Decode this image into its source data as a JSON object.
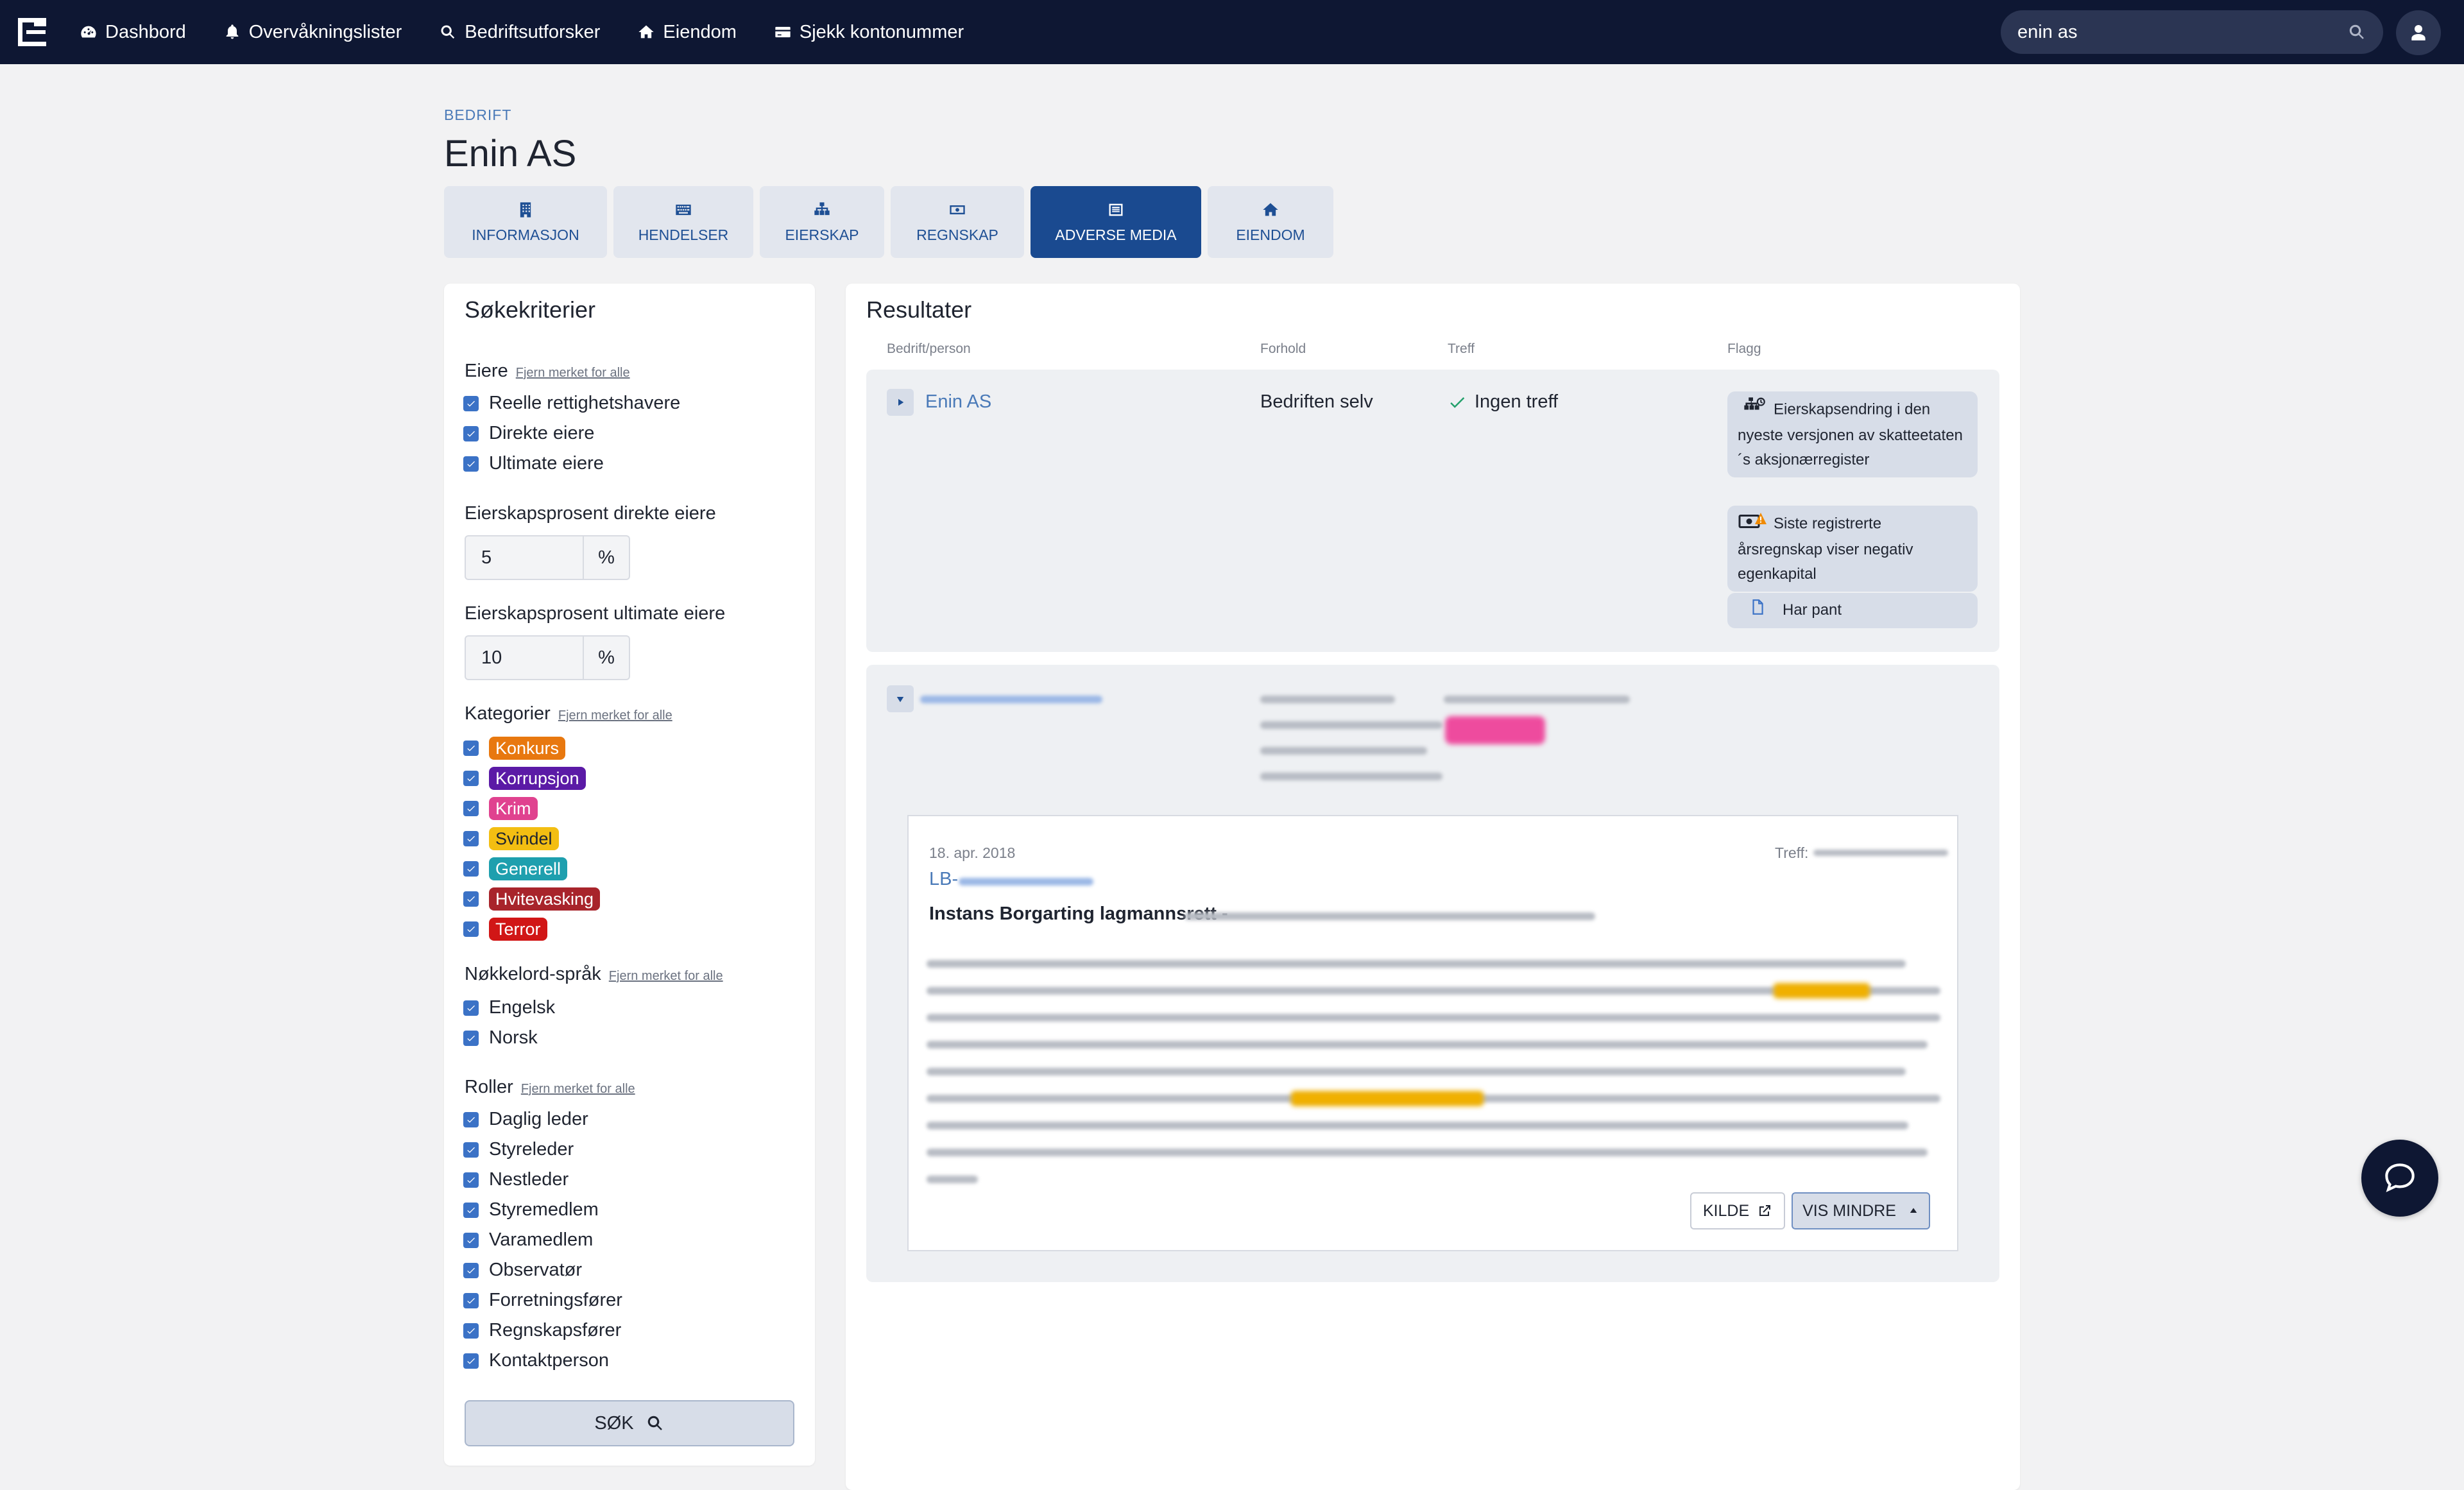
{
  "nav": {
    "items": [
      {
        "label": "Dashbord",
        "icon": "dashboard-icon"
      },
      {
        "label": "Overvåkningslister",
        "icon": "bell-icon"
      },
      {
        "label": "Bedriftsutforsker",
        "icon": "search-icon"
      },
      {
        "label": "Eiendom",
        "icon": "home-icon"
      },
      {
        "label": "Sjekk kontonummer",
        "icon": "card-icon"
      }
    ],
    "search_value": "enin as"
  },
  "page": {
    "crumb": "BEDRIFT",
    "title": "Enin AS"
  },
  "tabs": [
    {
      "label": "INFORMASJON",
      "icon": "building-icon",
      "active": false
    },
    {
      "label": "HENDELSER",
      "icon": "keyboard-icon",
      "active": false
    },
    {
      "label": "EIERSKAP",
      "icon": "sitemap-icon",
      "active": false
    },
    {
      "label": "REGNSKAP",
      "icon": "money-icon",
      "active": false
    },
    {
      "label": "ADVERSE MEDIA",
      "icon": "newspaper-icon",
      "active": true
    },
    {
      "label": "EIENDOM",
      "icon": "home-icon",
      "active": false
    }
  ],
  "criteria": {
    "title": "Søkekriterier",
    "clear_label": "Fjern merket for alle",
    "owners_label": "Eiere",
    "owners": [
      "Reelle rettighetshavere",
      "Direkte eiere",
      "Ultimate eiere"
    ],
    "pct_direct_label": "Eierskapsprosent direkte eiere",
    "pct_direct_value": "5",
    "pct_ultimate_label": "Eierskapsprosent ultimate eiere",
    "pct_ultimate_value": "10",
    "pct_suffix": "%",
    "categories_label": "Kategorier",
    "categories": [
      {
        "label": "Konkurs",
        "color": "#e8780f"
      },
      {
        "label": "Korrupsjon",
        "color": "#5b1aa6"
      },
      {
        "label": "Krim",
        "color": "#e0428f"
      },
      {
        "label": "Svindel",
        "color": "#f3be12"
      },
      {
        "label": "Generell",
        "color": "#1e9fae"
      },
      {
        "label": "Hvitevasking",
        "color": "#a8242b"
      },
      {
        "label": "Terror",
        "color": "#d11616"
      }
    ],
    "lang_label": "Nøkkelord-språk",
    "languages": [
      "Engelsk",
      "Norsk"
    ],
    "roles_label": "Roller",
    "roles": [
      "Daglig leder",
      "Styreleder",
      "Nestleder",
      "Styremedlem",
      "Varamedlem",
      "Observatør",
      "Forretningsfører",
      "Regnskapsfører",
      "Kontaktperson"
    ],
    "search_button": "SØK"
  },
  "results": {
    "title": "Resultater",
    "columns": [
      "Bedrift/person",
      "Forhold",
      "Treff",
      "Flagg"
    ],
    "row1": {
      "name": "Enin AS",
      "relation": "Bedriften selv",
      "hits": "Ingen treff",
      "flags": [
        "Eierskapsendring i den nyeste versjonen av skatteetaten´s aksjonærregister",
        "Siste registrerte årsregnskap viser negativ egenkapital",
        "Har pant"
      ]
    },
    "article": {
      "date": "18. apr. 2018",
      "treff_label": "Treff:",
      "lb_prefix": "LB-",
      "institution": "Instans Borgarting lagmannsrett -",
      "source_button": "KILDE",
      "less_button": "VIS MINDRE"
    }
  },
  "colors": {
    "nav_bg": "#0e1733",
    "accent": "#1a4a90",
    "link": "#4a7ab8",
    "check": "#22a06b"
  }
}
